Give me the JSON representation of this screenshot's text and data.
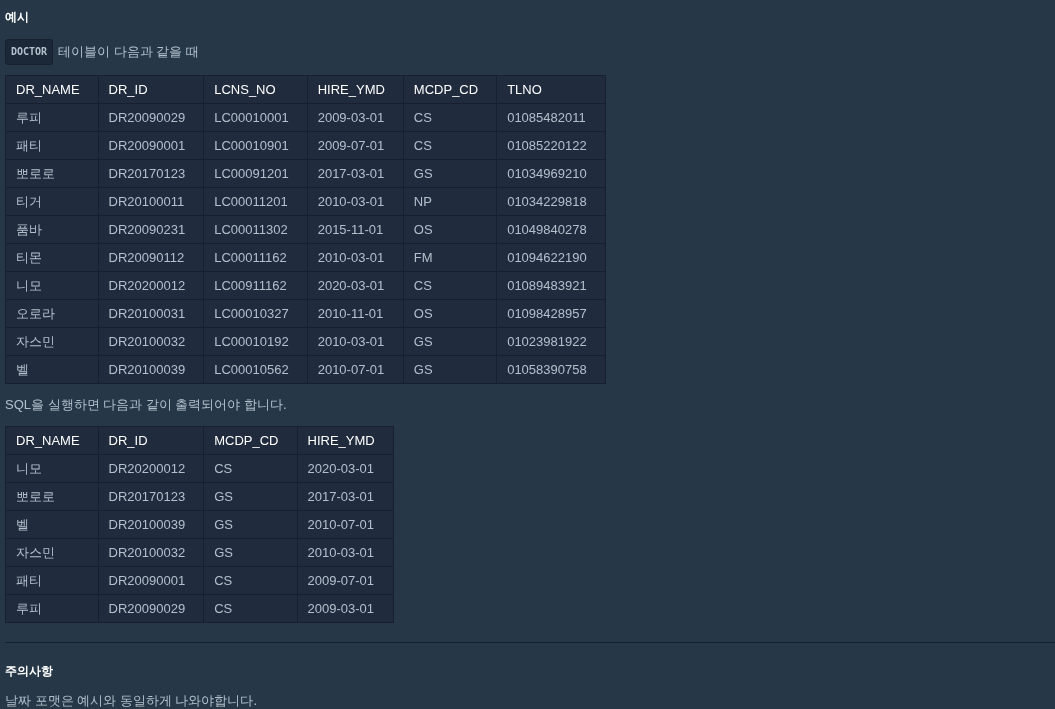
{
  "content": [
    {
      "kind": "heading",
      "text": "예시"
    },
    {
      "kind": "code_paragraph",
      "code": "DOCTOR",
      "text": "테이블이 다음과 같을 때"
    },
    {
      "kind": "table",
      "columns": [
        "DR_NAME",
        "DR_ID",
        "LCNS_NO",
        "HIRE_YMD",
        "MCDP_CD",
        "TLNO"
      ],
      "rows": [
        [
          "루피",
          "DR20090029",
          "LC00010001",
          "2009-03-01",
          "CS",
          "01085482011"
        ],
        [
          "패티",
          "DR20090001",
          "LC00010901",
          "2009-07-01",
          "CS",
          "01085220122"
        ],
        [
          "뽀로로",
          "DR20170123",
          "LC00091201",
          "2017-03-01",
          "GS",
          "01034969210"
        ],
        [
          "티거",
          "DR20100011",
          "LC00011201",
          "2010-03-01",
          "NP",
          "01034229818"
        ],
        [
          "품바",
          "DR20090231",
          "LC00011302",
          "2015-11-01",
          "OS",
          "01049840278"
        ],
        [
          "티몬",
          "DR20090112",
          "LC00011162",
          "2010-03-01",
          "FM",
          "01094622190"
        ],
        [
          "니모",
          "DR20200012",
          "LC00911162",
          "2020-03-01",
          "CS",
          "01089483921"
        ],
        [
          "오로라",
          "DR20100031",
          "LC00010327",
          "2010-11-01",
          "OS",
          "01098428957"
        ],
        [
          "자스민",
          "DR20100032",
          "LC00010192",
          "2010-03-01",
          "GS",
          "01023981922"
        ],
        [
          "벨",
          "DR20100039",
          "LC00010562",
          "2010-07-01",
          "GS",
          "01058390758"
        ]
      ]
    },
    {
      "kind": "paragraph",
      "text": "SQL을 실행하면 다음과 같이 출력되어야 합니다."
    },
    {
      "kind": "table",
      "columns": [
        "DR_NAME",
        "DR_ID",
        "MCDP_CD",
        "HIRE_YMD"
      ],
      "rows": [
        [
          "니모",
          "DR20200012",
          "CS",
          "2020-03-01"
        ],
        [
          "뽀로로",
          "DR20170123",
          "GS",
          "2017-03-01"
        ],
        [
          "벨",
          "DR20100039",
          "GS",
          "2010-07-01"
        ],
        [
          "자스민",
          "DR20100032",
          "GS",
          "2010-03-01"
        ],
        [
          "패티",
          "DR20090001",
          "CS",
          "2009-07-01"
        ],
        [
          "루피",
          "DR20090029",
          "CS",
          "2009-03-01"
        ]
      ]
    },
    {
      "kind": "divider"
    },
    {
      "kind": "heading",
      "text": "주의사항"
    },
    {
      "kind": "paragraph",
      "text": "날짜 포맷은 예시와 동일하게 나와야합니다."
    }
  ]
}
